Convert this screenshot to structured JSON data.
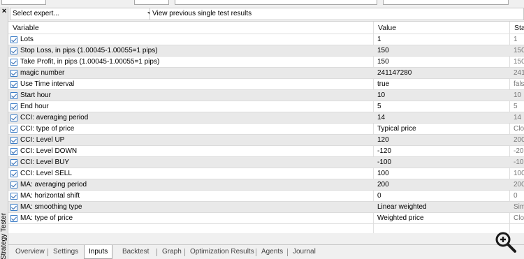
{
  "toolbar": {
    "expert_placeholder": "Select expert...",
    "previous_results_label": "View previous single test results"
  },
  "panel": {
    "title": "Strategy Tester",
    "close_glyph": "×"
  },
  "table": {
    "headers": {
      "variable": "Variable",
      "value": "Value",
      "start": "Sta"
    },
    "rows": [
      {
        "name": "Lots",
        "value": "1",
        "start": "1"
      },
      {
        "name": "Stop Loss, in pips (1.00045-1.00055=1 pips)",
        "value": "150",
        "start": "150"
      },
      {
        "name": "Take Profit, in pips (1.00045-1.00055=1 pips)",
        "value": "150",
        "start": "150"
      },
      {
        "name": "magic number",
        "value": "241147280",
        "start": "241"
      },
      {
        "name": "Use Time interval",
        "value": "true",
        "start": "fals"
      },
      {
        "name": "Start hour",
        "value": "10",
        "start": "10"
      },
      {
        "name": "End hour",
        "value": "5",
        "start": "5"
      },
      {
        "name": "CCI: averaging period",
        "value": "14",
        "start": "14"
      },
      {
        "name": "CCI: type of price",
        "value": "Typical price",
        "start": "Clo"
      },
      {
        "name": "CCI: Level UP",
        "value": "120",
        "start": "200"
      },
      {
        "name": "CCI: Level DOWN",
        "value": "-120",
        "start": "-20"
      },
      {
        "name": "CCI: Level BUY",
        "value": "-100",
        "start": "-10"
      },
      {
        "name": "CCI: Level SELL",
        "value": "100",
        "start": "100"
      },
      {
        "name": "MA: averaging period",
        "value": "200",
        "start": "200"
      },
      {
        "name": "MA: horizontal shift",
        "value": "0",
        "start": "0"
      },
      {
        "name": "MA: smoothing type",
        "value": "Linear weighted",
        "start": "Sim"
      },
      {
        "name": "MA: type of price",
        "value": "Weighted price",
        "start": "Clo"
      }
    ]
  },
  "tabs": [
    {
      "label": "Overview",
      "active": false
    },
    {
      "label": "Settings",
      "active": false
    },
    {
      "label": "Inputs",
      "active": true
    },
    {
      "label": "Backtest",
      "active": false
    },
    {
      "label": "Graph",
      "active": false
    },
    {
      "label": "Optimization Results",
      "active": false
    },
    {
      "label": "Agents",
      "active": false
    },
    {
      "label": "Journal",
      "active": false
    }
  ],
  "icons": {
    "zoom": "zoom-in-magnifier-icon",
    "checkbox": "checkbox-checked-icon",
    "dropdown": "chevron-down-icon"
  },
  "colors": {
    "checkbox_border": "#3b7dc7",
    "row_alt": "#e9e9e9",
    "background": "#f0f0f0"
  }
}
